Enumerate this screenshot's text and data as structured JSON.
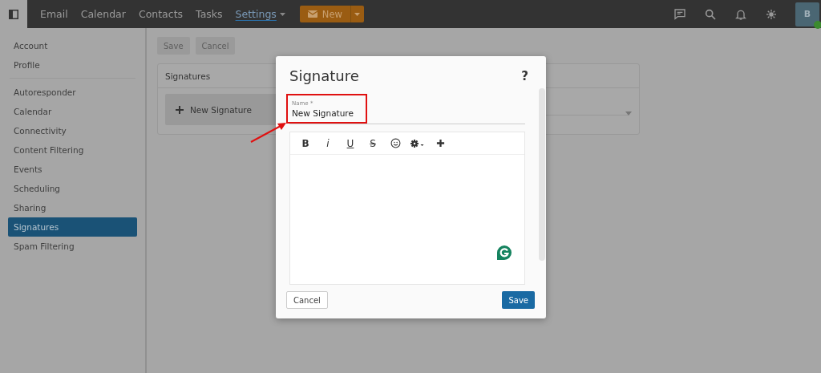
{
  "topbar": {
    "nav": [
      {
        "label": "Email",
        "selected": false
      },
      {
        "label": "Calendar",
        "selected": false
      },
      {
        "label": "Contacts",
        "selected": false
      },
      {
        "label": "Tasks",
        "selected": false
      },
      {
        "label": "Settings",
        "selected": true,
        "dropdown": true
      }
    ],
    "new_button": {
      "label": "New"
    },
    "avatar": {
      "initial": "B",
      "online": true
    }
  },
  "sidebar": {
    "groups": [
      {
        "items": [
          {
            "label": "Account",
            "selected": false
          },
          {
            "label": "Profile",
            "selected": false
          }
        ]
      },
      {
        "items": [
          {
            "label": "Autoresponder",
            "selected": false
          },
          {
            "label": "Calendar",
            "selected": false
          },
          {
            "label": "Connectivity",
            "selected": false
          },
          {
            "label": "Content Filtering",
            "selected": false
          },
          {
            "label": "Events",
            "selected": false
          },
          {
            "label": "Scheduling",
            "selected": false
          },
          {
            "label": "Sharing",
            "selected": false
          },
          {
            "label": "Signatures",
            "selected": true
          },
          {
            "label": "Spam Filtering",
            "selected": false
          }
        ]
      }
    ]
  },
  "actions": [
    {
      "label": "Save",
      "disabled": true
    },
    {
      "label": "Cancel",
      "disabled": true
    }
  ],
  "panel": {
    "title": "Signatures",
    "new_item": "New Signature"
  },
  "dialog": {
    "title": "Signature",
    "help": "?",
    "name_field": {
      "label": "Name *",
      "value": "New Signature",
      "highlighted": true
    },
    "toolbar": [
      {
        "kind": "bold",
        "label": "B"
      },
      {
        "kind": "italic",
        "label": "i"
      },
      {
        "kind": "underline",
        "label": "U"
      },
      {
        "kind": "strike",
        "label": "S"
      },
      {
        "kind": "emoji"
      },
      {
        "kind": "gear"
      },
      {
        "kind": "plus"
      }
    ],
    "cancel": "Cancel",
    "save": "Save"
  }
}
